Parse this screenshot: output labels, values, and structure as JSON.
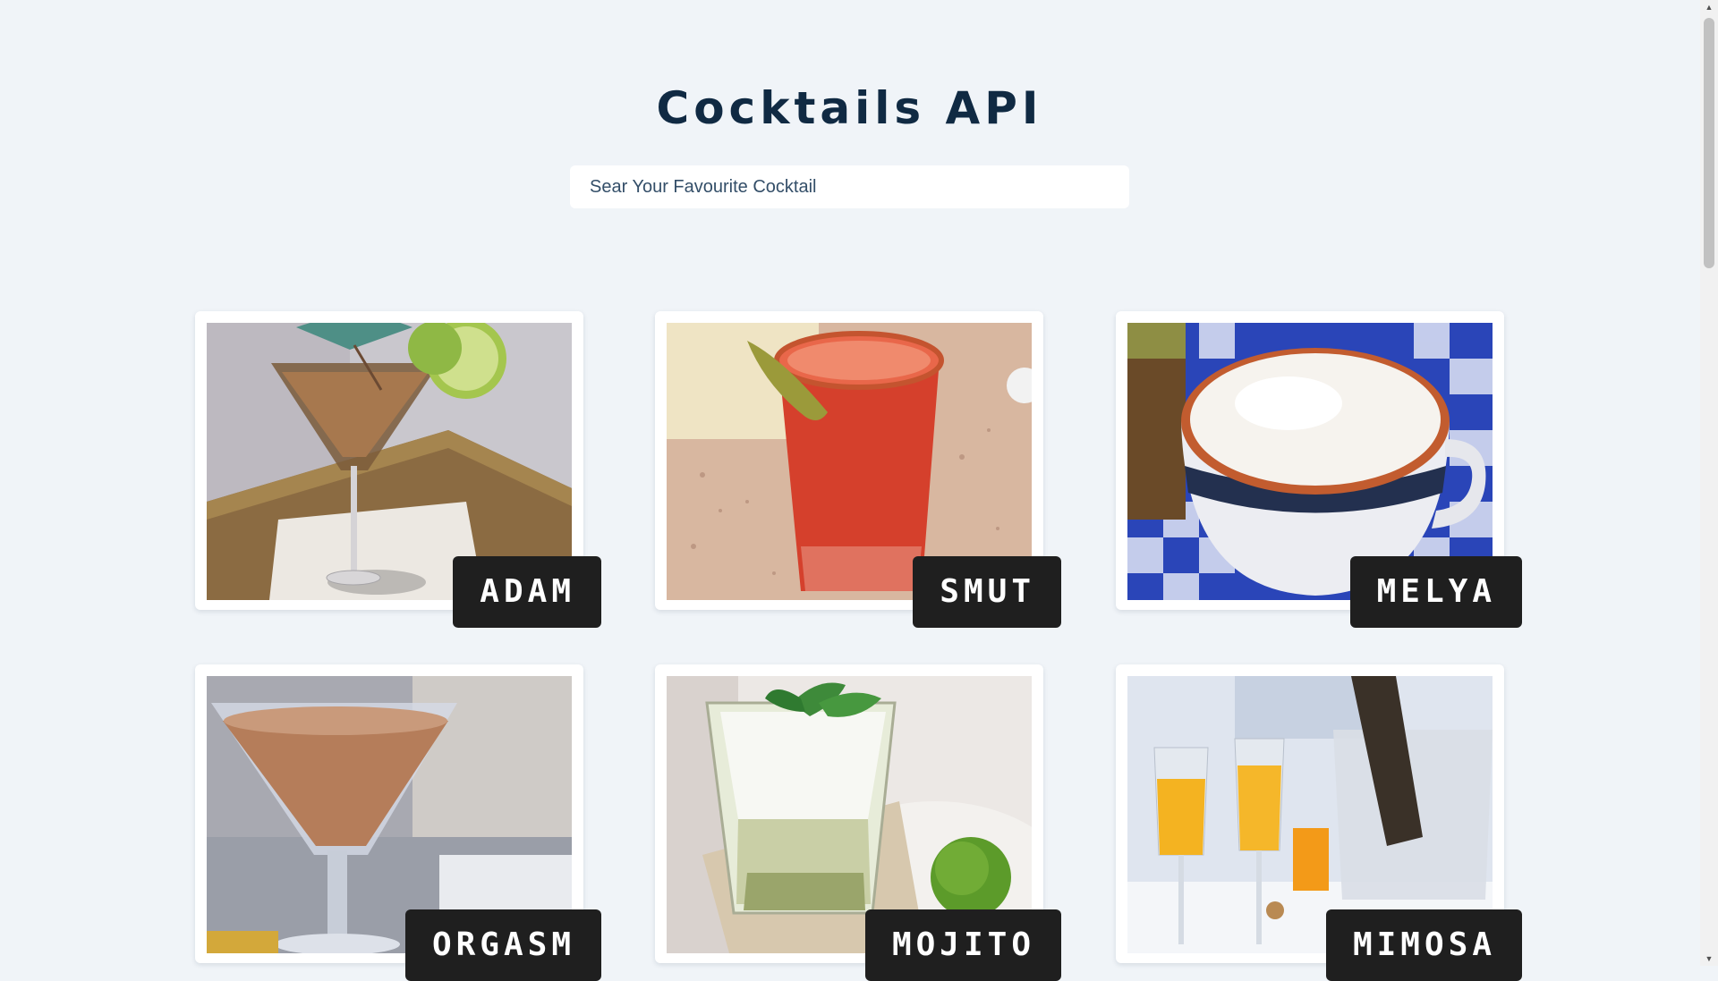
{
  "header": {
    "title": "Cocktails API"
  },
  "search": {
    "placeholder": "Sear Your Favourite Cocktail",
    "value": ""
  },
  "cocktails": [
    {
      "name": "ADAM",
      "image": "martini glass with brown cocktail, lime and umbrella garnish"
    },
    {
      "name": "SMUT",
      "image": "tall glass of red frozen cocktail with okra garnish"
    },
    {
      "name": "MELYA",
      "image": "coffee cup with frothy milk on blue checkered cloth"
    },
    {
      "name": "ORGASM",
      "image": "martini glass with creamy brown cocktail"
    },
    {
      "name": "MOJITO",
      "image": "glass with crushed ice, mint leaves and limes"
    },
    {
      "name": "MIMOSA",
      "image": "two champagne flutes with orange juice and bottle in ice bucket"
    }
  ],
  "colors": {
    "background": "#f0f4f8",
    "title": "#102a43",
    "name_badge": "#1f1f1f"
  },
  "icons": {
    "scroll_up": "scroll-up-arrow-icon",
    "scroll_down": "scroll-down-arrow-icon"
  }
}
